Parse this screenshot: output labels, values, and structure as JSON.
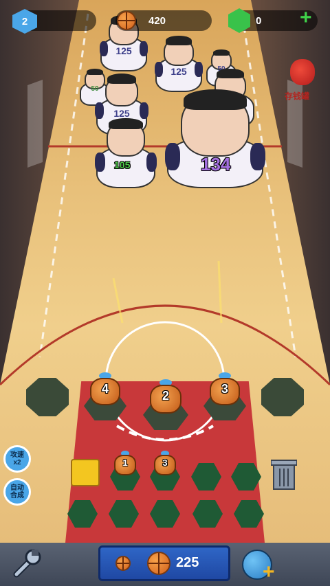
{
  "hud": {
    "level": "2",
    "coins": "420",
    "gems": "0",
    "add_label": "+"
  },
  "piggy_bank": {
    "label": "存钱罐"
  },
  "enemies": [
    {
      "jersey": "125"
    },
    {
      "jersey": "125"
    },
    {
      "jersey": "50"
    },
    {
      "jersey": "50"
    },
    {
      "jersey": "125"
    },
    {
      "jersey": "125"
    },
    {
      "jersey": "125"
    }
  ],
  "enemy_hp": {
    "left": "105",
    "right": "134"
  },
  "towers_active": [
    {
      "level": "4"
    },
    {
      "level": "2"
    },
    {
      "level": "3"
    }
  ],
  "towers_bench": [
    {
      "level": "1"
    },
    {
      "level": "3"
    }
  ],
  "side_buttons": {
    "attack_speed": "攻速\nx2",
    "auto_merge": "自动\n合成"
  },
  "buy": {
    "price": "225"
  },
  "colors": {
    "paint": "#c8383a",
    "slot": "#1f5a35",
    "accent": "#4aa6e8"
  }
}
